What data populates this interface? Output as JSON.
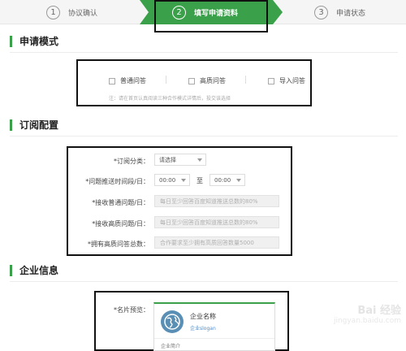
{
  "steps": [
    {
      "num": "1",
      "label": "协议确认"
    },
    {
      "num": "2",
      "label": "填写申请资料"
    },
    {
      "num": "3",
      "label": "申请状态"
    }
  ],
  "colors": {
    "accent": "#3aa14a",
    "annotation": "#111111"
  },
  "sections": {
    "mode": {
      "title": "申请模式",
      "options": [
        "普通问答",
        "高质问答",
        "导入问答"
      ],
      "note": "注：请在首页认真阅读三种合作模式详情后，投交该选择"
    },
    "subscription": {
      "title": "订阅配置",
      "category_label": "*订阅分类：",
      "category_value": "请选择",
      "period_label": "*问题推送时间段/日：",
      "time_from": "00:00",
      "to_label": "至",
      "time_to": "00:00",
      "normal_label": "*接收普通问题/日：",
      "normal_placeholder": "每日至少回答百度知道推送总数的80%",
      "hq_label": "*接收高质问题/日：",
      "hq_placeholder": "每日至少回答百度知道推送总数的80%",
      "total_label": "*拥有高质问答总数：",
      "total_placeholder": "合作要求至少拥有高质回答数量5000"
    },
    "company": {
      "title": "企业信息",
      "card_label": "*名片预览：",
      "card_name": "企业名称",
      "card_slogan": "企业slogan",
      "card_intro": "企业简介"
    }
  },
  "watermark": {
    "logo": "Bai 经验",
    "url": "jingyan.baidu.com"
  }
}
